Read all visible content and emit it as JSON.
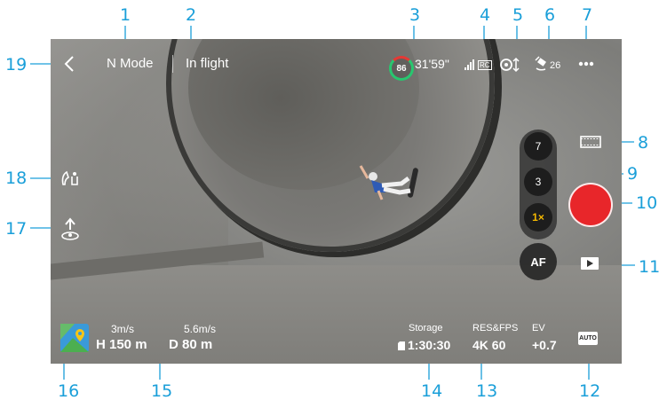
{
  "callouts": {
    "c1": "1",
    "c2": "2",
    "c3": "3",
    "c4": "4",
    "c5": "5",
    "c6": "6",
    "c7": "7",
    "c8": "8",
    "c9": "9",
    "c10": "10",
    "c11": "11",
    "c12": "12",
    "c13": "13",
    "c14": "14",
    "c15": "15",
    "c16": "16",
    "c17": "17",
    "c18": "18",
    "c19": "19"
  },
  "topbar": {
    "mode": "N Mode",
    "flight_status": "In flight",
    "battery_percent": "86",
    "flight_time": "31'59\"",
    "signal_label": "RC",
    "gps_count": "26",
    "more_icon": "more-dots-icon"
  },
  "zoom": {
    "z7": "7",
    "z3": "3",
    "z1": "1×"
  },
  "af_label": "AF",
  "telemetry": {
    "vspeed": "3m/s",
    "hspeed": "5.6m/s",
    "height": "H 150 m",
    "distance": "D 80 m"
  },
  "params": {
    "storage_label": "Storage",
    "storage_value": "1:30:30",
    "resfps_label": "RES&FPS",
    "resfps_value": "4K 60",
    "ev_label": "EV",
    "ev_value": "+0.7",
    "auto_label": "AUTO"
  },
  "colors": {
    "callout": "#1a9fd9",
    "record": "#e8262a",
    "battery_ok": "#28c76f",
    "battery_warn": "#e53935",
    "zoom_active": "#f5b800"
  }
}
